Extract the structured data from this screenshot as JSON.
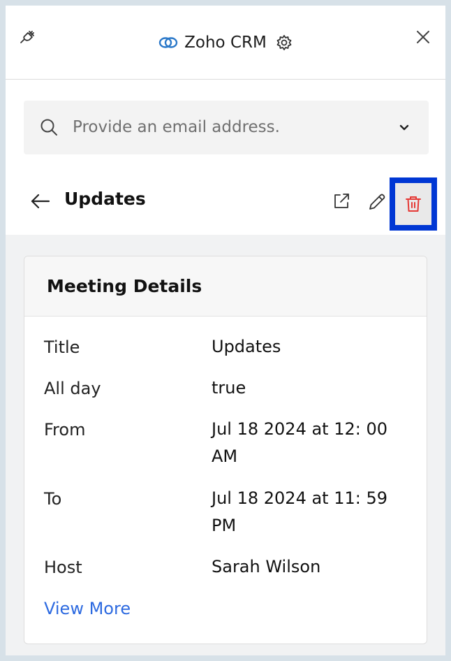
{
  "header": {
    "app_title": "Zoho CRM",
    "icons": [
      "plug-icon",
      "zoho-crm-logo-icon",
      "settings-gear-icon",
      "close-icon"
    ]
  },
  "search": {
    "placeholder": "Provide an email address.",
    "value": ""
  },
  "record": {
    "title": "Updates",
    "actions": [
      "open-external-icon",
      "edit-pencil-icon",
      "delete-trash-icon"
    ]
  },
  "card": {
    "title": "Meeting Details",
    "fields": [
      {
        "label": "Title",
        "value": "Updates"
      },
      {
        "label": "All day",
        "value": "true"
      },
      {
        "label": "From",
        "value": "Jul 18 2024 at 12: 00 AM"
      },
      {
        "label": "To",
        "value": "Jul 18 2024 at 11: 59 PM"
      },
      {
        "label": "Host",
        "value": "Sarah Wilson"
      }
    ],
    "view_more_label": "View More"
  },
  "colors": {
    "accent_link": "#2d6ae0",
    "delete_red": "#e53935",
    "highlight_border": "#0037d4",
    "brand_blue": "#2a78c9"
  }
}
